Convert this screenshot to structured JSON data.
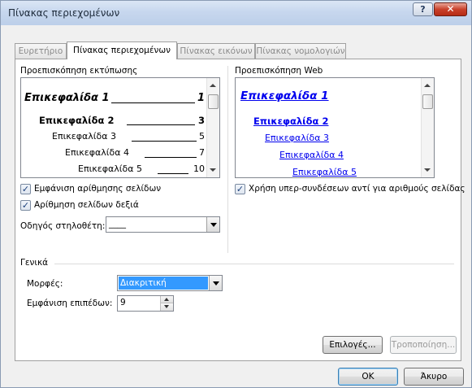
{
  "window": {
    "title": "Πίνακας περιεχομένων",
    "help_glyph": "?",
    "close_glyph": "✕"
  },
  "tabs": [
    "Ευρετήριο",
    "Πίνακας περιεχομένων",
    "Πίνακας εικόνων",
    "Πίνακας νομολογιών"
  ],
  "print_preview": {
    "label": "Προεπισκόπηση εκτύπωσης",
    "lines": [
      {
        "text": "Επικεφαλίδα 1",
        "page": "1"
      },
      {
        "text": "Επικεφαλίδα 2",
        "page": "3"
      },
      {
        "text": "Επικεφαλίδα 3",
        "page": "5"
      },
      {
        "text": "Επικεφαλίδα 4",
        "page": "7"
      },
      {
        "text": "Επικεφαλίδα 5",
        "page": "10"
      }
    ]
  },
  "web_preview": {
    "label": "Προεπισκόπηση Web",
    "links": [
      "Επικεφαλίδα 1",
      "Επικεφαλίδα 2",
      "Επικεφαλίδα 3",
      "Επικεφαλίδα 4",
      "Επικεφαλίδα 5"
    ]
  },
  "options": {
    "show_page_numbers": "Εμφάνιση αρίθμησης σελίδων",
    "right_align": "Αρίθμηση σελίδων δεξιά",
    "tab_leader_label": "Οδηγός στηλοθέτη:",
    "tab_leader_value": "____",
    "use_hyperlinks": "Χρήση υπερ-συνδέσεων αντί για αριθμούς σελίδας",
    "check_glyph": "✓"
  },
  "general": {
    "title": "Γενικά",
    "formats_label": "Μορφές:",
    "formats_value": "Διακριτική",
    "levels_label": "Εμφάνιση επιπέδων:",
    "levels_value": "9"
  },
  "buttons": {
    "options": "Επιλογές...",
    "modify": "Τροποποίηση...",
    "ok": "OK",
    "cancel": "Άκυρο"
  },
  "colors": {
    "link": "#0000ee",
    "selected": "#3399ff"
  }
}
